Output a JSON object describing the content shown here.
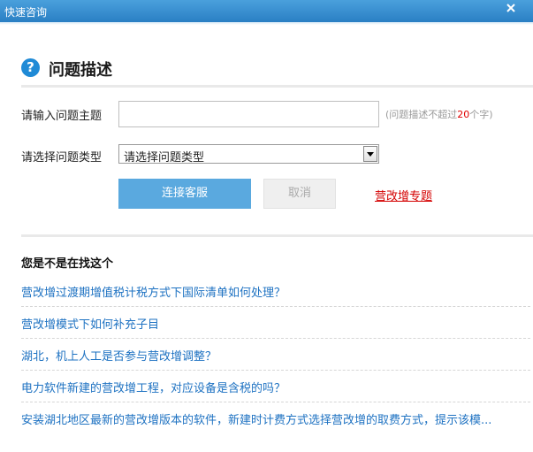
{
  "window": {
    "title": "快速咨询"
  },
  "section": {
    "title": "问题描述"
  },
  "form": {
    "subject_label": "请输入问题主题",
    "subject_value": "",
    "subject_hint_prefix": "(问题描述不超过",
    "subject_hint_num": "20",
    "subject_hint_suffix": "个字)",
    "type_label": "请选择问题类型",
    "type_selected": "请选择问题类型",
    "connect_button": "连接客服",
    "cancel_button": "取消",
    "topic_link": "营改增专题"
  },
  "suggestions": {
    "title": "您是不是在找这个",
    "items": [
      "营改增过渡期增值税计税方式下国际清单如何处理？",
      "营改增模式下如何补充子目",
      "湖北，机上人工是否参与营改增调整？",
      "电力软件新建的营改增工程，对应设备是含税的吗？",
      "安装湖北地区最新的营改增版本的软件，新建时计费方式选择营改增的取费方式，提示该模..."
    ]
  },
  "colors": {
    "titlebar": "#2a7fc4",
    "primary_button": "#5aa9df",
    "link": "#1e72c2",
    "topic_link": "#d40000",
    "hint_number": "#e00000"
  },
  "icons": {
    "title_close": "close-icon",
    "section": "question-circle-icon",
    "select_arrow": "caret-down-icon"
  }
}
